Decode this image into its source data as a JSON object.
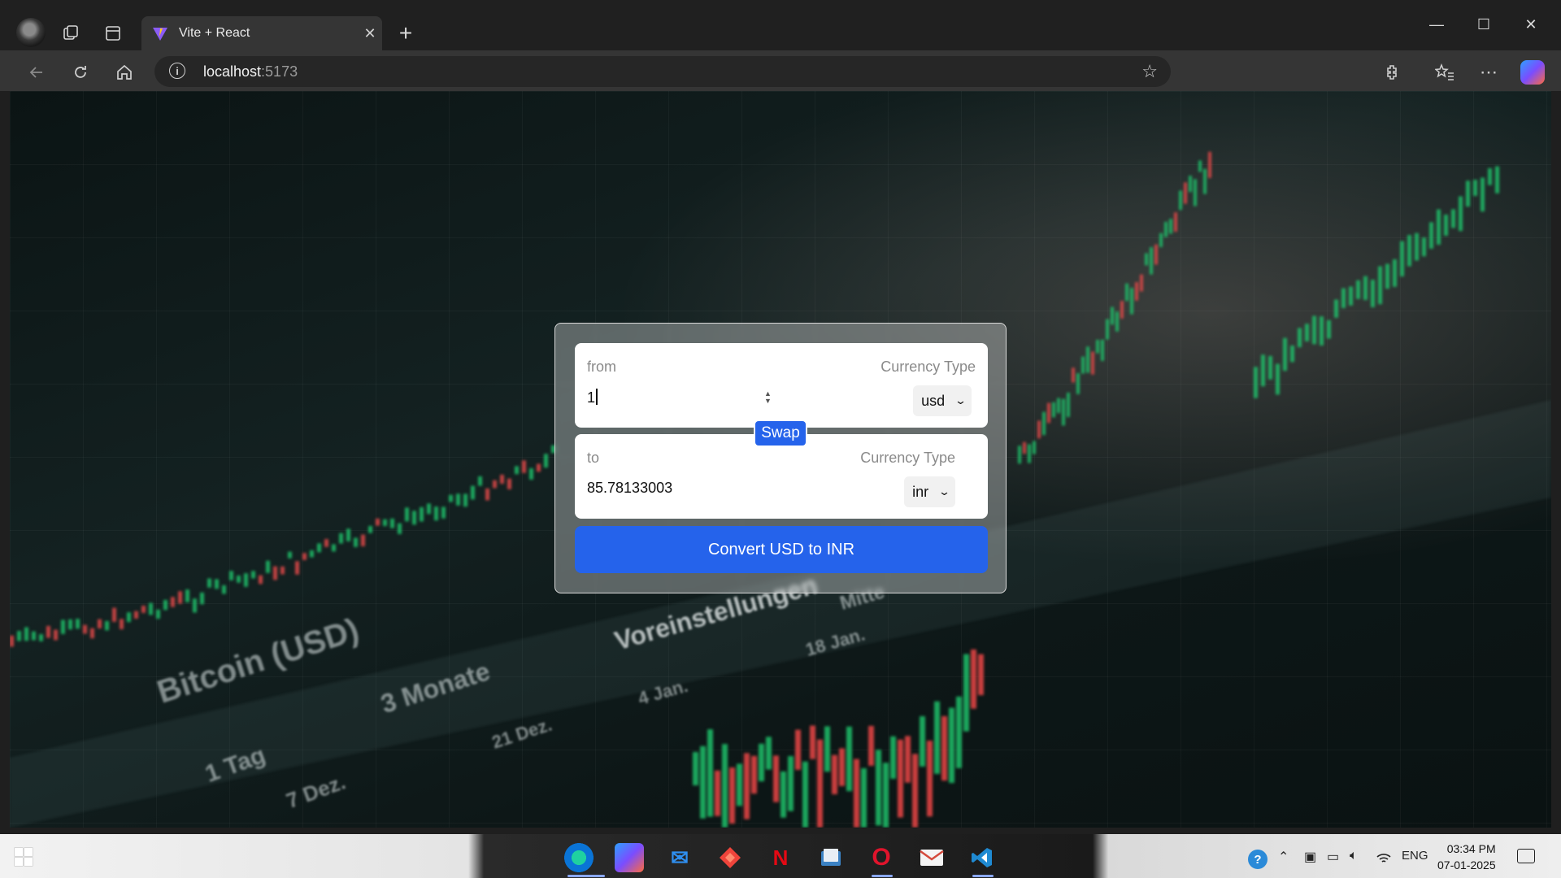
{
  "browser": {
    "tab_title": "Vite + React",
    "tab_close": "✕",
    "new_tab": "+",
    "address_host": "localhost",
    "address_port": ":5173",
    "window_controls": {
      "minimize": "—",
      "maximize": "☐",
      "close": "✕"
    }
  },
  "converter": {
    "from": {
      "label": "from",
      "currency_label": "Currency Type",
      "amount": "1",
      "currency": "usd"
    },
    "swap_label": "Swap",
    "to": {
      "label": "to",
      "currency_label": "Currency Type",
      "amount": "85.78133003",
      "currency": "inr"
    },
    "convert_label": "Convert USD to INR"
  },
  "background_text": {
    "bitcoin": "Bitcoin (USD)",
    "months": "3 Monate",
    "settings": "Voreinstellungen",
    "mitte": "Mitte",
    "jan18": "18 Jan.",
    "jan4": "4 Jan.",
    "dec21": "21 Dez.",
    "day1": "1 Tag",
    "dec7": "7 Dez."
  },
  "taskbar": {
    "lang": "ENG",
    "time": "03:34 PM",
    "date": "07-01-2025"
  },
  "colors": {
    "accent": "#2563eb",
    "chrome_dark": "#202020",
    "toolbar": "#353535"
  }
}
